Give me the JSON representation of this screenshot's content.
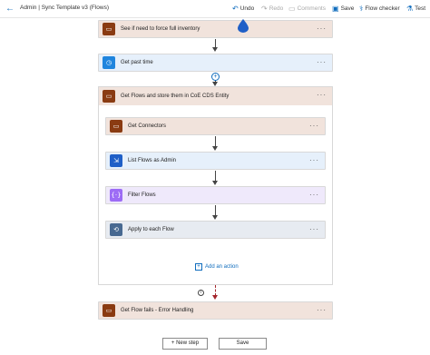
{
  "header": {
    "title": "Admin | Sync Template v3 (Flows)",
    "undo": "Undo",
    "redo": "Redo",
    "comments": "Comments",
    "save": "Save",
    "flow_checker": "Flow checker",
    "test": "Test"
  },
  "steps": {
    "force_inventory": "See if need to force full inventory",
    "get_past_time": "Get past time",
    "scope": "Get Flows and store them in CoE CDS Entity",
    "get_connectors": "Get Connectors",
    "list_flows": "List Flows as Admin",
    "filter_flows": "Filter Flows",
    "apply_each": "Apply to each Flow",
    "add_action": "Add an action",
    "flow_fails": "Get Flow fails - Error Handling"
  },
  "footer": {
    "new_step": "+ New step",
    "save": "Save"
  },
  "colors": {
    "brown": "#8a3b12",
    "blue": "#1f85de",
    "purple": "#9d6cf5",
    "slate": "#486991",
    "power_automate": "#1f5fc7"
  }
}
